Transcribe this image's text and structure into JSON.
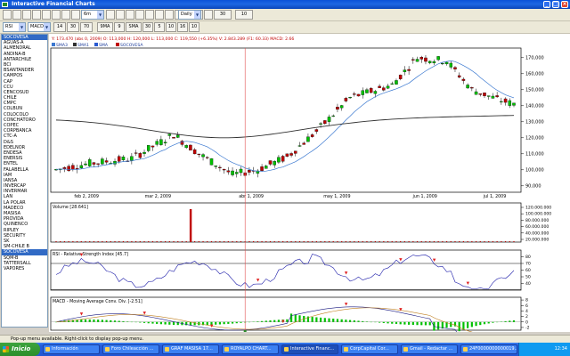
{
  "window": {
    "title": "Interactive Financial Charts"
  },
  "toolbar1": {
    "buttons": [
      "1",
      "2",
      "3",
      "4",
      "5",
      "6",
      "7",
      "8",
      "9",
      "10",
      "11",
      "12",
      "13",
      "14",
      "15",
      "16",
      "17",
      "18",
      "19",
      "20"
    ],
    "period_select": "6m",
    "interval_select": "Daily",
    "small_controls": [
      "30",
      "10"
    ]
  },
  "toolbar2": {
    "indicator1": "RSI",
    "indicator2": "MACD",
    "values": [
      "14",
      "30",
      "70"
    ],
    "labels": [
      "9MA",
      "9",
      "SMA",
      "30",
      "5",
      "10",
      "16",
      "10"
    ]
  },
  "sidebar": {
    "header": "SOCOVESA",
    "items": [
      "AGUAS-A",
      "ALMENDRAL",
      "ANDINA-B",
      "ANTARCHILE",
      "BCI",
      "BSANTANDER",
      "CAMPOS",
      "CAP",
      "CCU",
      "CENCOSUD",
      "CHILE",
      "CMPC",
      "COLBUN",
      "COLOCOLO",
      "CONCHATORO",
      "COPEC",
      "CORPBANCA",
      "CTC-A",
      "D&S",
      "EDELNOR",
      "ENDESA",
      "ENERSIS",
      "ENTEL",
      "FALABELLA",
      "IAM",
      "IANSA",
      "INVERCAP",
      "INVERMAR",
      "LAN",
      "LA POLAR",
      "MADECO",
      "MASISA",
      "PROVIDA",
      "QUINENCO",
      "RIPLEY",
      "SECURITY",
      "SK",
      "SM-CHILE B",
      "SOCOVESA",
      "SQM-B",
      "TATTERSALL",
      "VAPORES"
    ],
    "selected_index": 38
  },
  "chart": {
    "info_line": "Y: 173.470 (abs 0, 2009) O: 113,000 H: 120,000 L: 113,000 C: 119,550 (+6.35%) V: 2.843.289 (F1: 60.33) MACD: 2.66",
    "legend": [
      "SMA3",
      "SMA1",
      "SMA",
      "SOCOVESA"
    ],
    "ohlc_line": "SOCOVESA (O: 140,000  H: 142,000  L: 141,500  C: 142,000) (+1.43%)",
    "price_ticks": [
      "170,000",
      "160,000",
      "150,000",
      "140,000",
      "130,000",
      "120,000",
      "110,000",
      "100,000",
      "90,000"
    ],
    "date_labels": [
      "feb 2, 2009",
      "mar 2, 2009",
      "abr 1, 2009",
      "may 1, 2009",
      "jun 1, 2009",
      "jul 1, 2009"
    ],
    "volume_title": "Volume [28.641]",
    "volume_ticks": [
      "120.000.000",
      "100.000.000",
      "80.000.000",
      "60.000.000",
      "40.000.000",
      "20.000.000"
    ],
    "rsi_title": "RSI - Relative Strength Index [45.7]",
    "rsi_ticks": [
      "80",
      "70",
      "60",
      "50",
      "40"
    ],
    "macd_title": "MACD - Moving Average Conv. Div. [-2.51]",
    "macd_ticks": [
      "8",
      "6",
      "4",
      "2",
      "0",
      "-2"
    ],
    "colors": {
      "up": "#00c000",
      "down": "#c00000",
      "sma_long": "#303030",
      "sma_short": "#3a78d0",
      "cursor": "#e05050",
      "rsi": "#1a1aa8",
      "macd_signal": "#c08020"
    }
  },
  "status": {
    "text": "Pop-up menu available. Right-click to display pop-up menu."
  },
  "taskbar": {
    "start": "Inicio",
    "tasks": [
      "Información",
      "Foro Chileacción ...",
      "GRAF MASISA 17...",
      "ROYALPO CHART...",
      "Interactive Financ...",
      "CorpCapital Cor...",
      "Gmail - Redactar ...",
      "24F0000000000019..."
    ],
    "active_index": 4,
    "clock": "12:34"
  }
}
